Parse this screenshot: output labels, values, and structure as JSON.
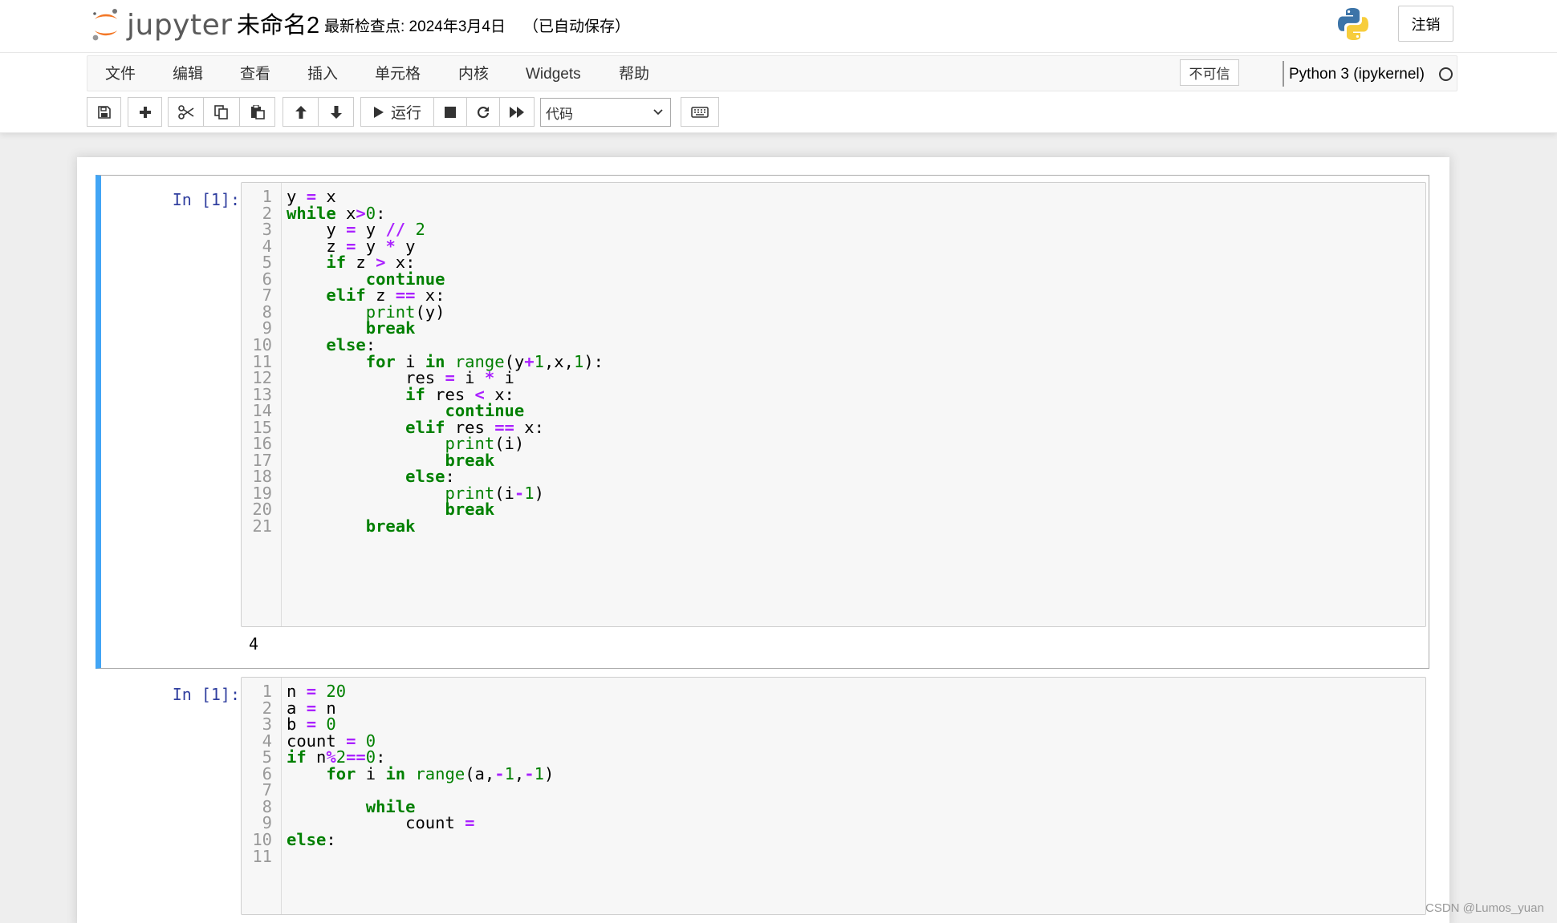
{
  "header": {
    "logo_text": "jupyter",
    "notebook_name": "未命名2",
    "checkpoint": "最新检查点: 2024年3月4日",
    "autosave": "（已自动保存）",
    "logout_label": "注销"
  },
  "menubar": {
    "items": [
      "文件",
      "编辑",
      "查看",
      "插入",
      "单元格",
      "内核",
      "Widgets",
      "帮助"
    ],
    "trust_label": "不可信",
    "kernel_name": "Python 3 (ipykernel)"
  },
  "toolbar": {
    "run_label": "运行",
    "cell_type": "代码"
  },
  "cells": [
    {
      "prompt": "In [1]:",
      "line_numbers": [
        "1",
        "2",
        "3",
        "4",
        "5",
        "6",
        "7",
        "8",
        "9",
        "10",
        "11",
        "12",
        "13",
        "14",
        "15",
        "16",
        "17",
        "18",
        "19",
        "20",
        "21"
      ],
      "output": "4"
    },
    {
      "prompt": "In [1]:",
      "line_numbers": [
        "1",
        "2",
        "3",
        "4",
        "5",
        "6",
        "7",
        "8",
        "9",
        "10",
        "11"
      ]
    }
  ],
  "watermark": "CSDN @Lumos_yuan"
}
